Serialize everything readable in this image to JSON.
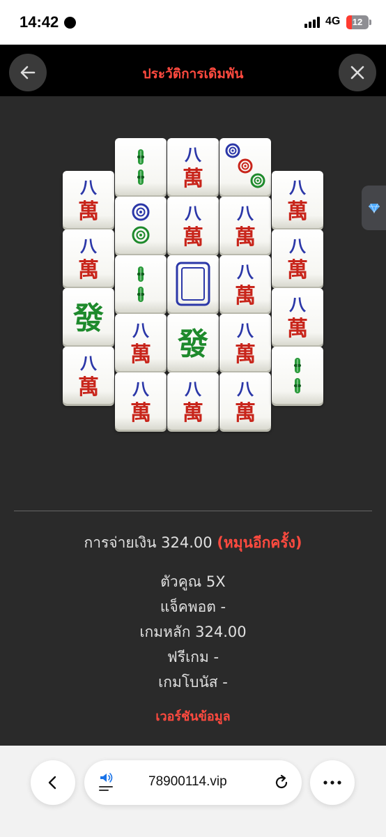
{
  "status_bar": {
    "time": "14:42",
    "network": "4G",
    "battery": "12"
  },
  "header": {
    "title": "ประวัติการเดิมพัน"
  },
  "tiles": [
    {
      "kind": "wan8"
    },
    {
      "kind": "wan8"
    },
    {
      "kind": "green-dragon"
    },
    {
      "kind": "wan8"
    },
    {
      "kind": "bamboo-2"
    },
    {
      "kind": "circles-2"
    },
    {
      "kind": "bamboo-2"
    },
    {
      "kind": "wan8"
    },
    {
      "kind": "wan8"
    },
    {
      "kind": "wan8"
    },
    {
      "kind": "wan8"
    },
    {
      "kind": "white-dragon"
    },
    {
      "kind": "green-dragon"
    },
    {
      "kind": "wan8"
    },
    {
      "kind": "circles-3"
    },
    {
      "kind": "wan8"
    },
    {
      "kind": "wan8"
    },
    {
      "kind": "wan8"
    },
    {
      "kind": "wan8"
    },
    {
      "kind": "wan8"
    },
    {
      "kind": "wan8"
    },
    {
      "kind": "wan8"
    },
    {
      "kind": "bamboo-2"
    }
  ],
  "summary": {
    "payout_label": "การจ่ายเงิน 324.00",
    "respin_label": "(หมุนอีกครั้ง)",
    "multiplier": "ตัวคูณ 5X",
    "jackpot": "แจ็คพอต -",
    "main_game": "เกมหลัก 324.00",
    "free_game": "ฟรีเกม -",
    "bonus_game": "เกมโบนัส -",
    "version_info": "เวอร์ชันข้อมูล"
  },
  "browser": {
    "url": "78900114.vip"
  },
  "icons": {
    "back": "arrow-left-icon",
    "close": "close-icon",
    "side": "diamond-icon",
    "nav_back": "chevron-left-icon",
    "sound": "speaker-icon",
    "reload": "reload-icon",
    "more": "more-icon"
  },
  "colors": {
    "accent_red": "#ff4a3f",
    "panel_bg": "#2a2a2a",
    "header_bg": "#000000"
  }
}
